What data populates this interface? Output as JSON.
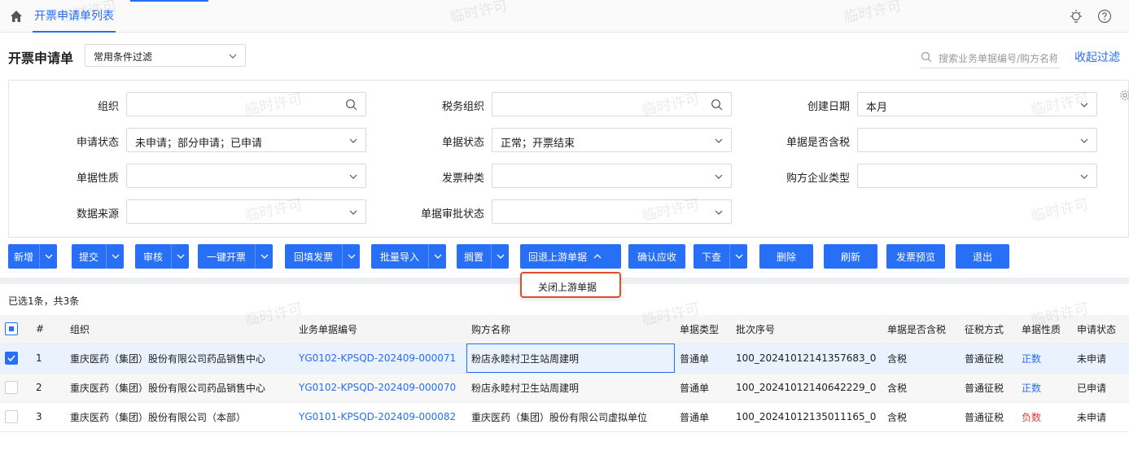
{
  "topbar": {
    "tab_label": "开票申请单列表"
  },
  "header": {
    "title": "开票申请单",
    "filter_select": "常用条件过滤",
    "search_placeholder": "搜索业务单据编号/购方名称",
    "collapse_label": "收起过滤"
  },
  "filters": {
    "org_label": "组织",
    "org_value": "",
    "tax_org_label": "税务组织",
    "tax_org_value": "",
    "create_date_label": "创建日期",
    "create_date_value": "本月",
    "apply_status_label": "申请状态",
    "apply_status_value": "未申请；部分申请；已申请",
    "doc_status_label": "单据状态",
    "doc_status_value": "正常；开票结束",
    "tax_included_label": "单据是否含税",
    "tax_included_value": "",
    "doc_nature_label": "单据性质",
    "doc_nature_value": "",
    "invoice_type_label": "发票种类",
    "invoice_type_value": "",
    "buyer_type_label": "购方企业类型",
    "buyer_type_value": "",
    "data_source_label": "数据来源",
    "data_source_value": "",
    "approval_status_label": "单据审批状态",
    "approval_status_value": ""
  },
  "toolbar": {
    "new": "新增",
    "submit": "提交",
    "audit": "审核",
    "one_click_invoice": "一键开票",
    "backfill_invoice": "回填发票",
    "batch_import": "批量导入",
    "shelve": "搁置",
    "return_upstream": "回退上游单据",
    "confirm_receivable": "确认应收",
    "drill_down": "下查",
    "delete": "删除",
    "refresh": "刷新",
    "invoice_preview": "发票预览",
    "exit": "退出"
  },
  "dropdown": {
    "item": "关闭上游单据"
  },
  "selection_info": "已选1条，共3条",
  "table": {
    "headers": [
      "#",
      "组织",
      "业务单据编号",
      "购方名称",
      "单据类型",
      "批次序号",
      "单据是否含税",
      "征税方式",
      "单据性质",
      "申请状态"
    ],
    "rows": [
      {
        "no": "1",
        "org": "重庆医药（集团）股份有限公司药品销售中心",
        "doc_no": "YG0102-KPSQD-202409-000071",
        "buyer": "粉店永睦村卫生站周建明",
        "doc_type": "普通单",
        "batch": "100_20241012141357683_0",
        "tax": "含税",
        "levy": "普通征税",
        "nature": "正数",
        "status": "未申请",
        "checked": true
      },
      {
        "no": "2",
        "org": "重庆医药（集团）股份有限公司药品销售中心",
        "doc_no": "YG0102-KPSQD-202409-000070",
        "buyer": "粉店永睦村卫生站周建明",
        "doc_type": "普通单",
        "batch": "100_20241012140642229_0",
        "tax": "含税",
        "levy": "普通征税",
        "nature": "正数",
        "status": "已申请",
        "checked": false
      },
      {
        "no": "3",
        "org": "重庆医药（集团）股份有限公司（本部）",
        "doc_no": "YG0101-KPSQD-202409-000082",
        "buyer": "重庆医药（集团）股份有限公司虚拟单位",
        "doc_type": "普通单",
        "batch": "100_20241012135011165_0",
        "tax": "含税",
        "levy": "普通征税",
        "nature": "负数",
        "status": "未申请",
        "checked": false
      }
    ]
  },
  "colors": {
    "accent": "#276ff5",
    "negative": "#e53935",
    "highlight": "#e04f2a"
  },
  "watermark": "临时许可"
}
